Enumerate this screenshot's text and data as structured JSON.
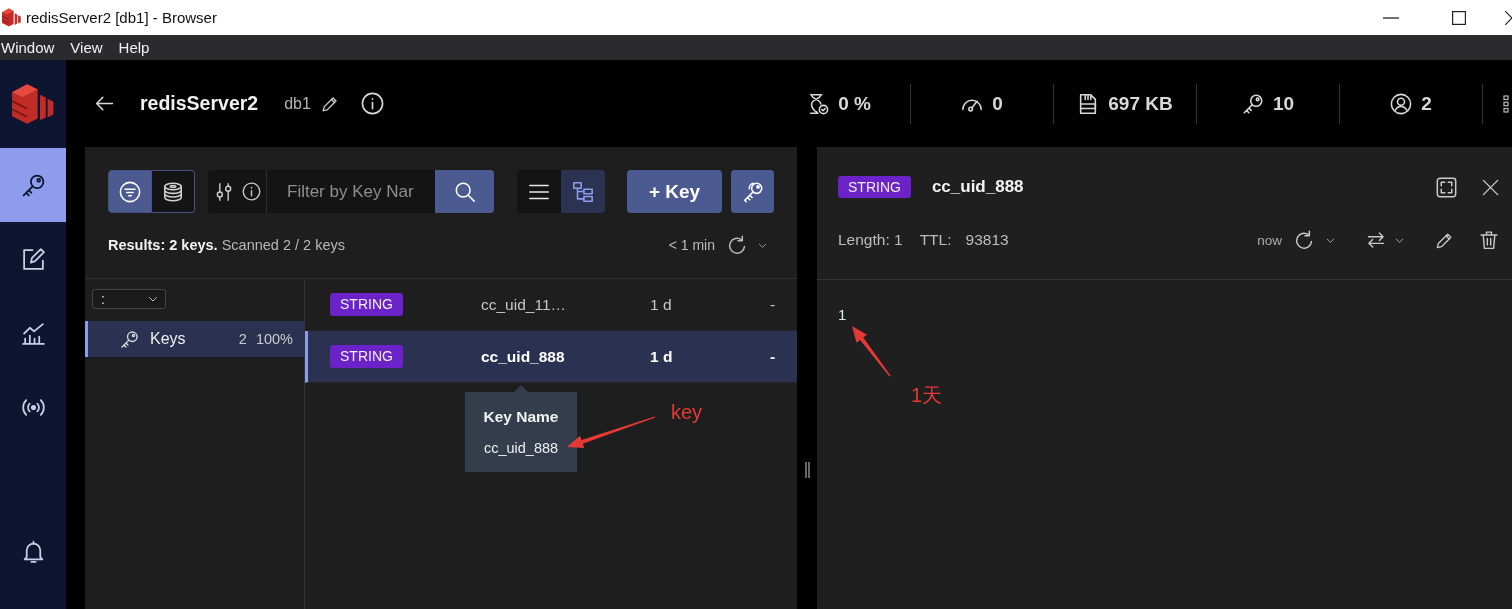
{
  "window": {
    "title": "redisServer2 [db1] - Browser"
  },
  "menu_bar": [
    "Window",
    "View",
    "Help"
  ],
  "nav": {
    "items": [
      {
        "selected": true
      },
      {
        "selected": false
      },
      {
        "selected": false
      },
      {
        "selected": false
      }
    ]
  },
  "header": {
    "database": "redisServer2",
    "db": "db1",
    "stats": [
      {
        "value": "0 %"
      },
      {
        "value": "0"
      },
      {
        "value": "697 KB"
      },
      {
        "value": "10"
      },
      {
        "value": "2"
      }
    ]
  },
  "browser": {
    "filter_modes": [
      {
        "selected": true
      },
      {
        "selected": false
      }
    ],
    "search": {
      "placeholder": "Filter by Key Nar"
    },
    "views": [
      {
        "selected": false
      },
      {
        "selected": true
      }
    ],
    "add_button": "+ Key",
    "summary": "**Results: 2 keys.** Scanned 2 / 2 keys",
    "last_refresh": "< 1 min",
    "tree": {
      "delimiter": ":",
      "folders": [
        {
          "name": "Keys",
          "count": "2",
          "share": "100%",
          "selected": true
        }
      ]
    },
    "rows": [
      {
        "type": "STRING",
        "name": "cc_uid_11…",
        "ttl": "1 d",
        "size": "-",
        "selected": false
      },
      {
        "type": "STRING",
        "name": "cc_uid_888",
        "ttl": "1 d",
        "size": "-",
        "selected": true
      }
    ],
    "tooltip": {
      "title": "Key Name",
      "value": "cc_uid_888"
    }
  },
  "details": {
    "type": "STRING",
    "name": "cc_uid_888",
    "length": "Length: 1",
    "ttl_label": "TTL:",
    "ttl": "93813",
    "refreshed": "now",
    "value": "1"
  },
  "annotations": [
    {
      "text": "key"
    },
    {
      "text": "1天"
    }
  ]
}
